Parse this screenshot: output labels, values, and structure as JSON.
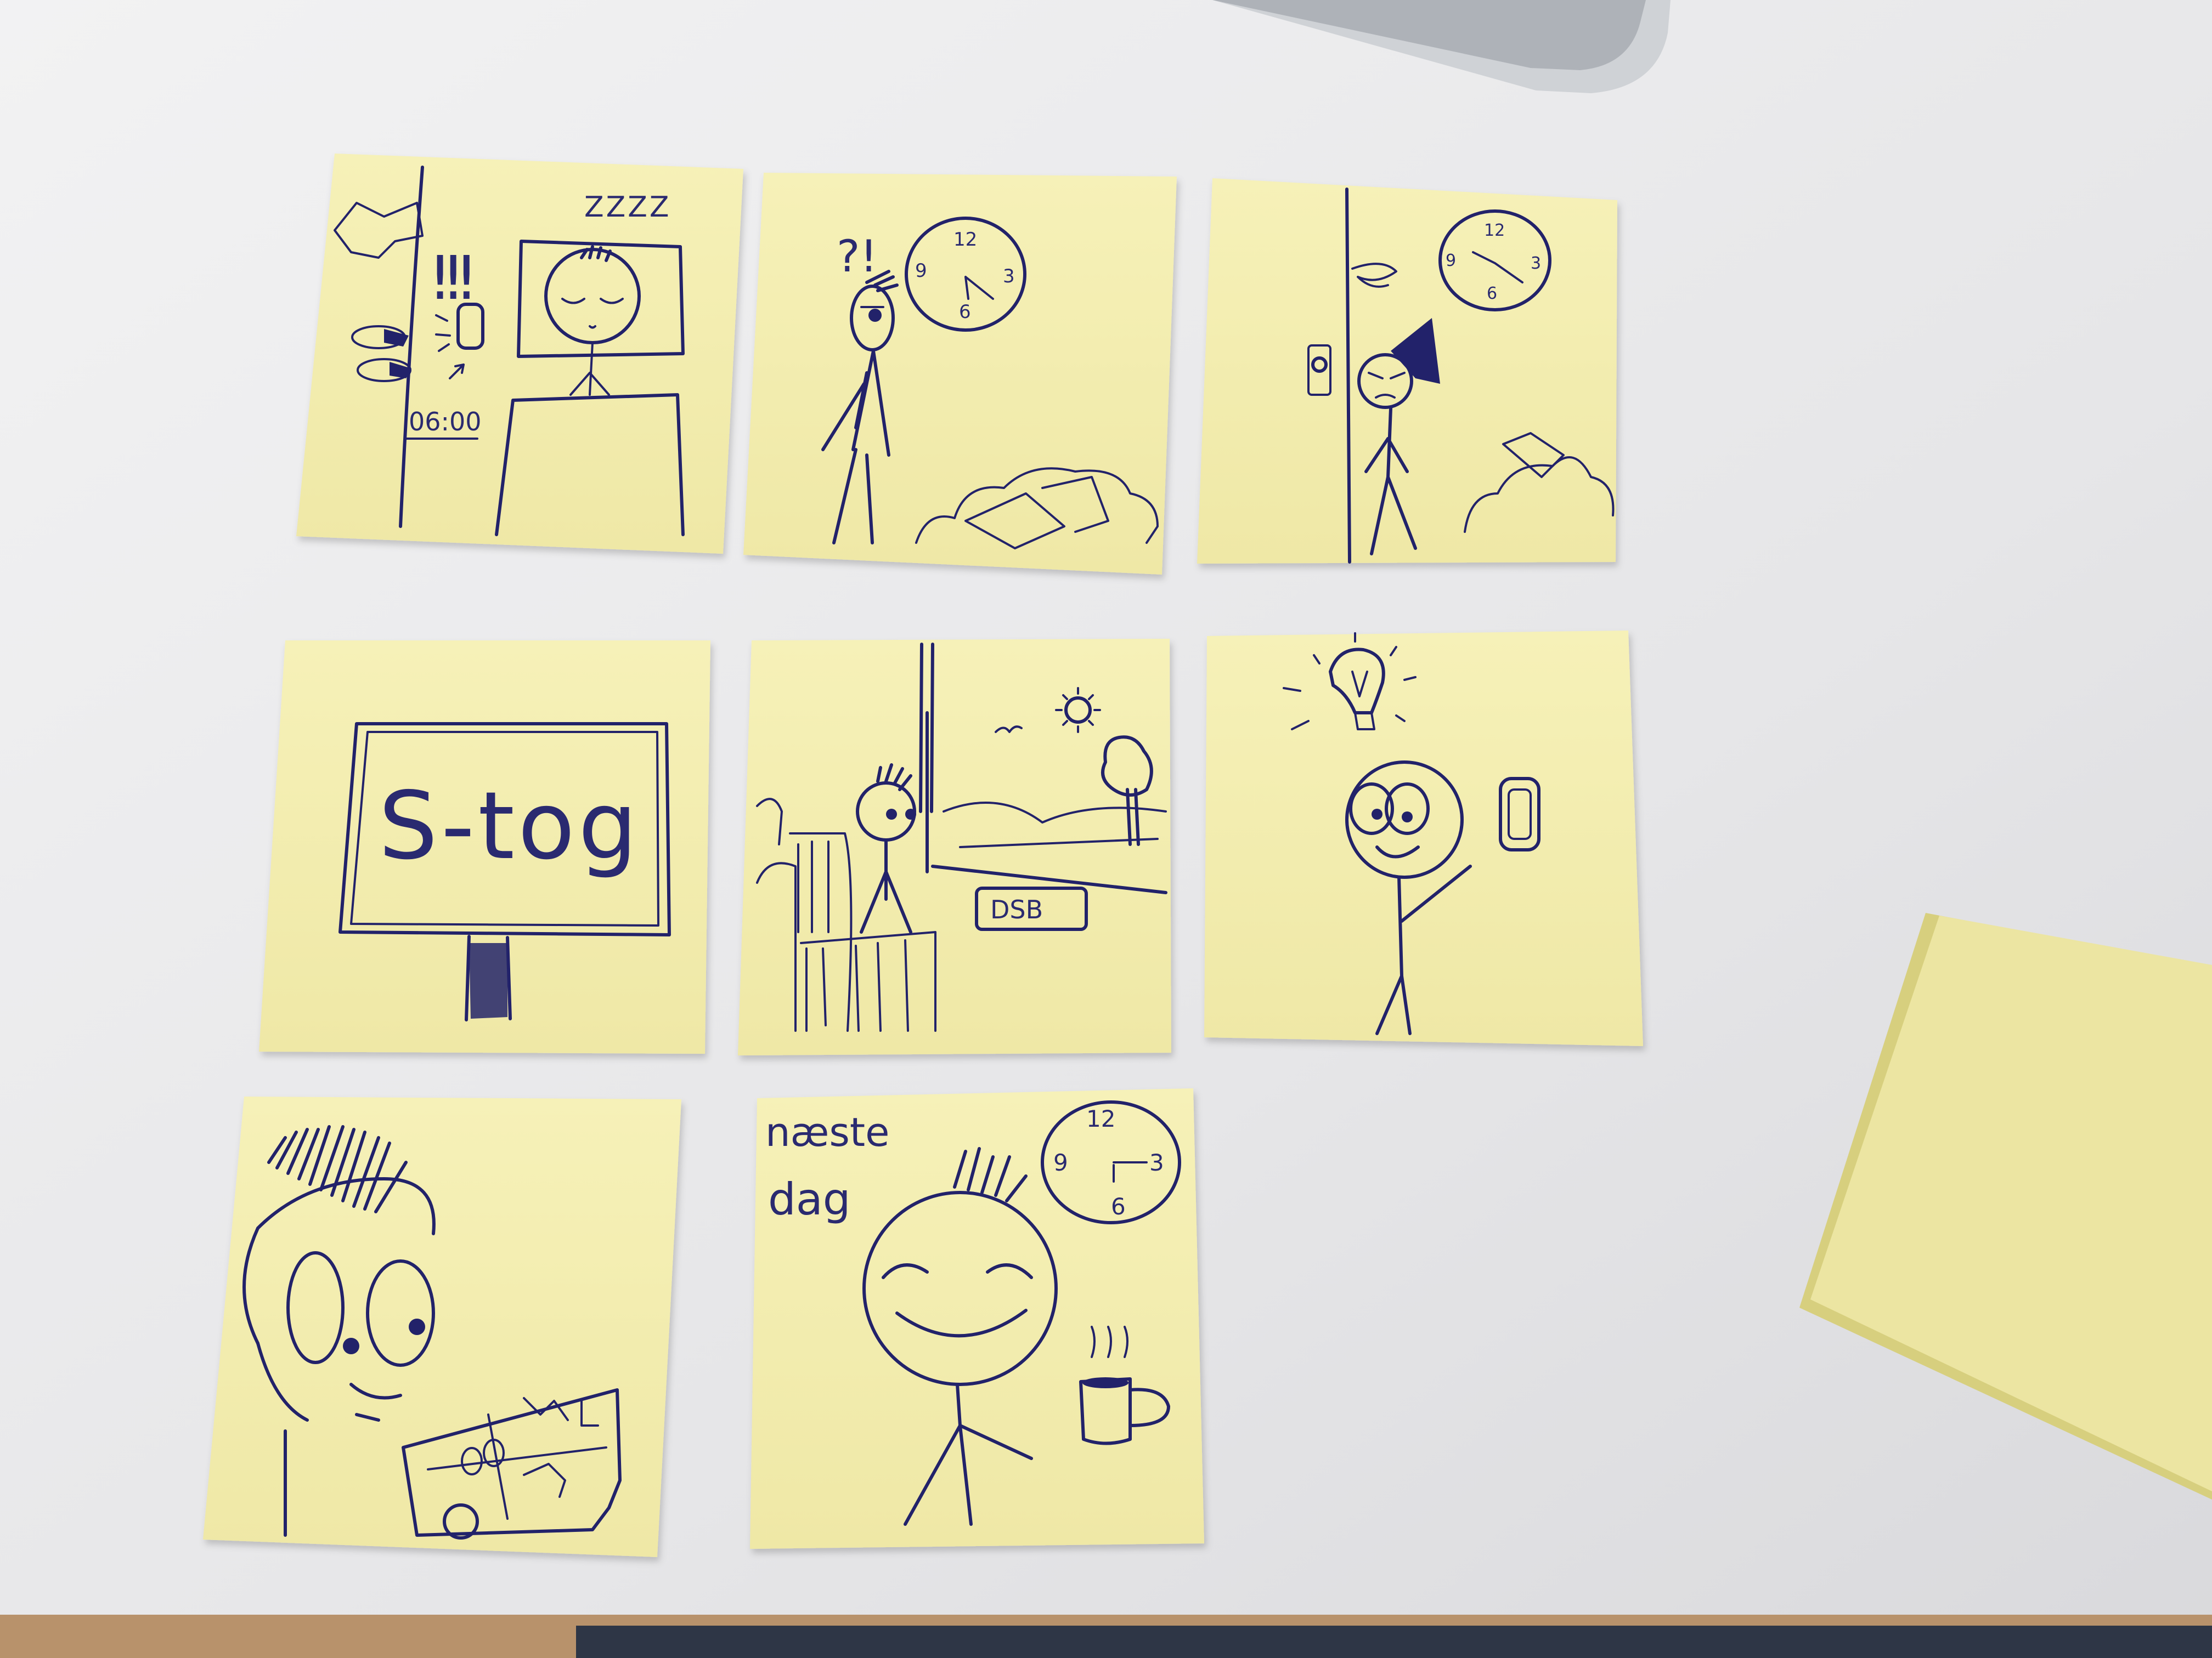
{
  "scene": {
    "description_free": true,
    "colors": {
      "desk": "#e9e9ea",
      "note": "#f3eeb0",
      "pen": "#23246a",
      "monitor": "#c9ccd0"
    }
  },
  "notes": [
    {
      "id": "note-1",
      "texts": {
        "zzz": "ZZZZ",
        "exclaim": "!!!",
        "alarm_time": "06:00"
      }
    },
    {
      "id": "note-2",
      "texts": {
        "question": "?!",
        "clock_12": "12",
        "clock_3": "3",
        "clock_6": "6",
        "clock_9": "9"
      }
    },
    {
      "id": "note-3",
      "texts": {
        "clock_12": "12",
        "clock_3": "3",
        "clock_6": "6",
        "clock_9": "9"
      }
    },
    {
      "id": "note-4",
      "texts": {
        "sign": "S-tog"
      }
    },
    {
      "id": "note-5",
      "texts": {
        "sign": "DSB"
      }
    },
    {
      "id": "note-6",
      "texts": {}
    },
    {
      "id": "note-7",
      "texts": {}
    },
    {
      "id": "note-8",
      "texts": {
        "line1": "næste",
        "line2": "dag",
        "clock_12": "12",
        "clock_3": "3",
        "clock_6": "6",
        "clock_9": "9"
      }
    }
  ]
}
